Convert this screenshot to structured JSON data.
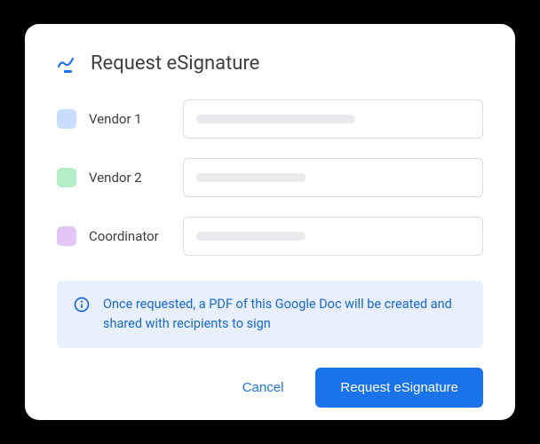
{
  "dialog": {
    "title": "Request eSignature",
    "signers": [
      {
        "label": "Vendor 1",
        "color": "#c9defc",
        "placeholder_width": "58%"
      },
      {
        "label": "Vendor 2",
        "color": "#b6eeca",
        "placeholder_width": "40%"
      },
      {
        "label": "Coordinator",
        "color": "#e3c6f7",
        "placeholder_width": "40%"
      }
    ],
    "info_text": "Once requested, a PDF of this Google Doc will be created and shared with recipients to sign",
    "actions": {
      "cancel": "Cancel",
      "primary": "Request eSignature"
    }
  }
}
